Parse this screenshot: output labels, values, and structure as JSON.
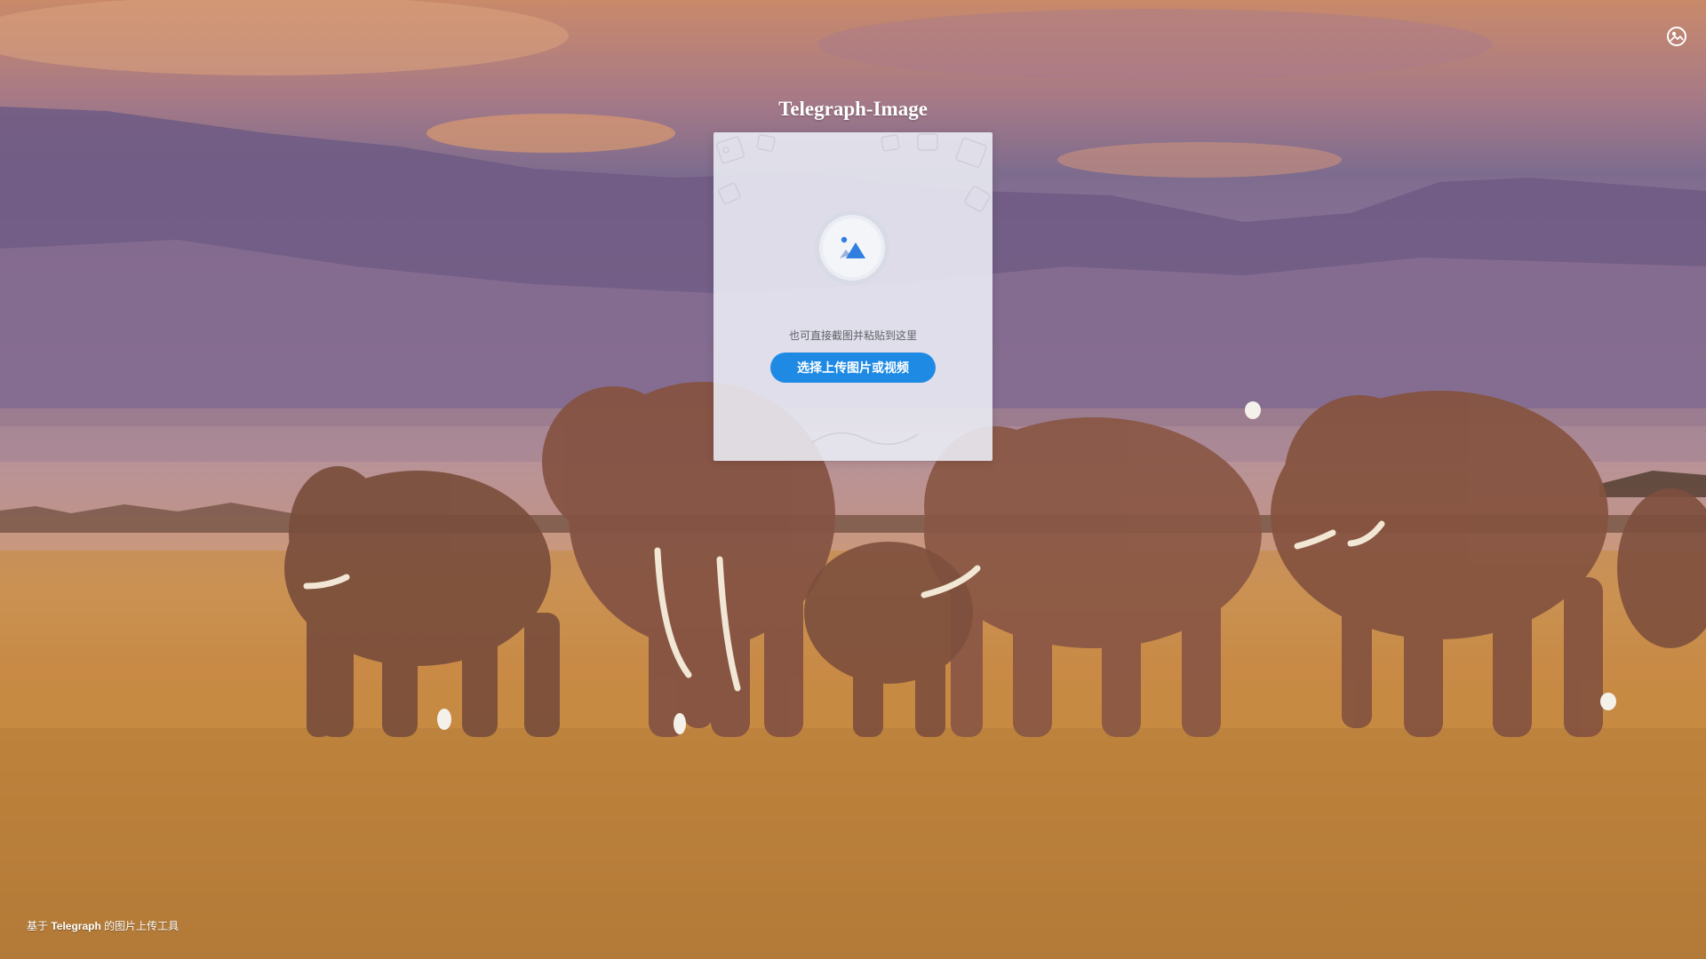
{
  "app": {
    "title": "Telegraph-Image"
  },
  "upload": {
    "hint": "也可直接截图并粘贴到这里",
    "button_label": "选择上传图片或视频"
  },
  "footer": {
    "prefix": "基于",
    "brand": "Telegraph",
    "suffix": "的图片上传工具"
  },
  "icons": {
    "settings": "image-settings-icon",
    "upload": "image-upload-icon"
  },
  "colors": {
    "accent": "#1f8ae4",
    "card": "#eceef6",
    "title": "#ffffff"
  }
}
